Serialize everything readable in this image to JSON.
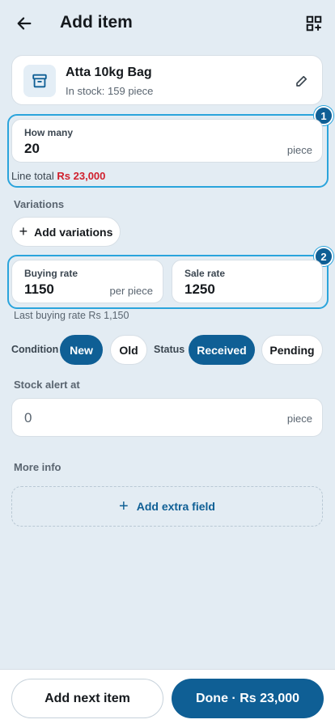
{
  "header": {
    "title": "Add item"
  },
  "item": {
    "name": "Atta 10kg Bag",
    "stock": "In stock: 159 piece"
  },
  "badges": {
    "one": "1",
    "two": "2"
  },
  "quantity": {
    "label": "How many",
    "value": "20",
    "unit": "piece"
  },
  "line_total": {
    "label": "Line total",
    "amount": "Rs 23,000"
  },
  "variations": {
    "label": "Variations",
    "add_label": "Add variations",
    "plus": "+"
  },
  "rates": {
    "buying_label": "Buying rate",
    "buying_value": "1150",
    "buying_unit": "per piece",
    "sale_label": "Sale rate",
    "sale_value": "1250",
    "last_buying": "Last buying rate Rs 1,150"
  },
  "condition": {
    "label": "Condition",
    "options": [
      "New",
      "Old"
    ],
    "selected": "New"
  },
  "status": {
    "label": "Status",
    "options": [
      "Received",
      "Pending"
    ],
    "selected": "Received"
  },
  "stock_alert": {
    "label": "Stock alert at",
    "value": "0",
    "unit": "piece"
  },
  "more_info": {
    "label": "More info",
    "add_label": "Add extra field",
    "plus": "+"
  },
  "footer": {
    "next_label": "Add next item",
    "done_label": "Done · Rs 23,000"
  },
  "colors": {
    "accent": "#0f5f95",
    "highlight": "#2aa4dc",
    "total": "#d01f2c",
    "background": "#e3ecf3"
  },
  "icons": {
    "back": "arrow-left-icon",
    "qr": "qr-add-icon",
    "item": "archive-box-icon",
    "edit": "pencil-icon"
  }
}
